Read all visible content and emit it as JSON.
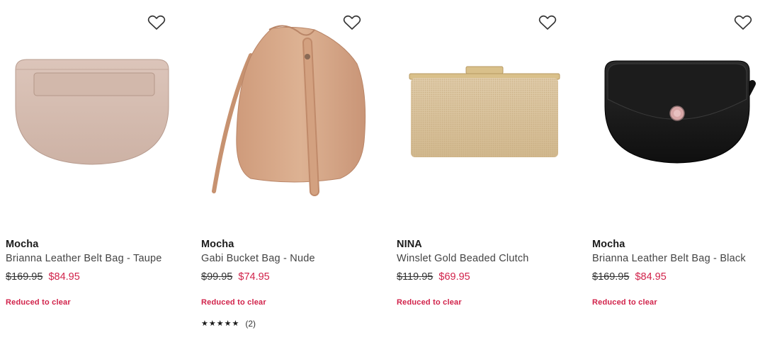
{
  "products": [
    {
      "brand": "Mocha",
      "name": "Brianna Leather Belt Bag - Taupe",
      "price_was": "$169.95",
      "price_now": "$84.95",
      "promo": "Reduced to clear",
      "image_icon": "taupe-belt-bag",
      "color": "#d6bcb0"
    },
    {
      "brand": "Mocha",
      "name": "Gabi Bucket Bag - Nude",
      "price_was": "$99.95",
      "price_now": "$74.95",
      "promo": "Reduced to clear",
      "image_icon": "nude-bucket-bag",
      "color": "#d8a98a",
      "rating": {
        "stars": 5,
        "count_text": "(2)"
      }
    },
    {
      "brand": "NINA",
      "name": "Winslet Gold Beaded Clutch",
      "price_was": "$119.95",
      "price_now": "$69.95",
      "promo": "Reduced to clear",
      "image_icon": "gold-beaded-clutch",
      "color": "#d9c39e"
    },
    {
      "brand": "Mocha",
      "name": "Brianna Leather Belt Bag - Black",
      "price_was": "$169.95",
      "price_now": "$84.95",
      "promo": "Reduced to clear",
      "image_icon": "black-belt-bag",
      "color": "#1a1a1a"
    }
  ],
  "colors": {
    "sale_price": "#d1224a",
    "promo": "#d1224a",
    "text": "#1b1b1b"
  },
  "icons": {
    "wishlist": "heart-outline-icon",
    "star": "star-icon"
  }
}
